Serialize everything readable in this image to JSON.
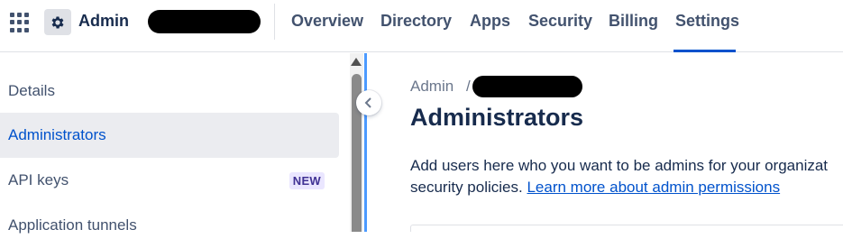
{
  "header": {
    "app_title": "Admin",
    "nav_tabs": [
      {
        "label": "Overview"
      },
      {
        "label": "Directory"
      },
      {
        "label": "Apps"
      },
      {
        "label": "Security"
      },
      {
        "label": "Billing"
      },
      {
        "label": "Settings",
        "active": true
      }
    ],
    "accent_color": "#0052cc"
  },
  "sidebar": {
    "items": [
      {
        "label": "Details"
      },
      {
        "label": "Administrators",
        "selected": true
      },
      {
        "label": "API keys",
        "badge": "NEW"
      },
      {
        "label": "Application tunnels"
      }
    ]
  },
  "main": {
    "breadcrumb_root": "Admin",
    "breadcrumb_separator": "/",
    "title": "Administrators",
    "description_line1": "Add users here who you want to be admins for your organizat",
    "description_line2": "security policies.",
    "learn_more_link": "Learn more about admin permissions"
  },
  "icons": {
    "app_switcher": "grid-icon",
    "admin_logo": "gear-icon",
    "collapse": "chevron-left-icon"
  }
}
